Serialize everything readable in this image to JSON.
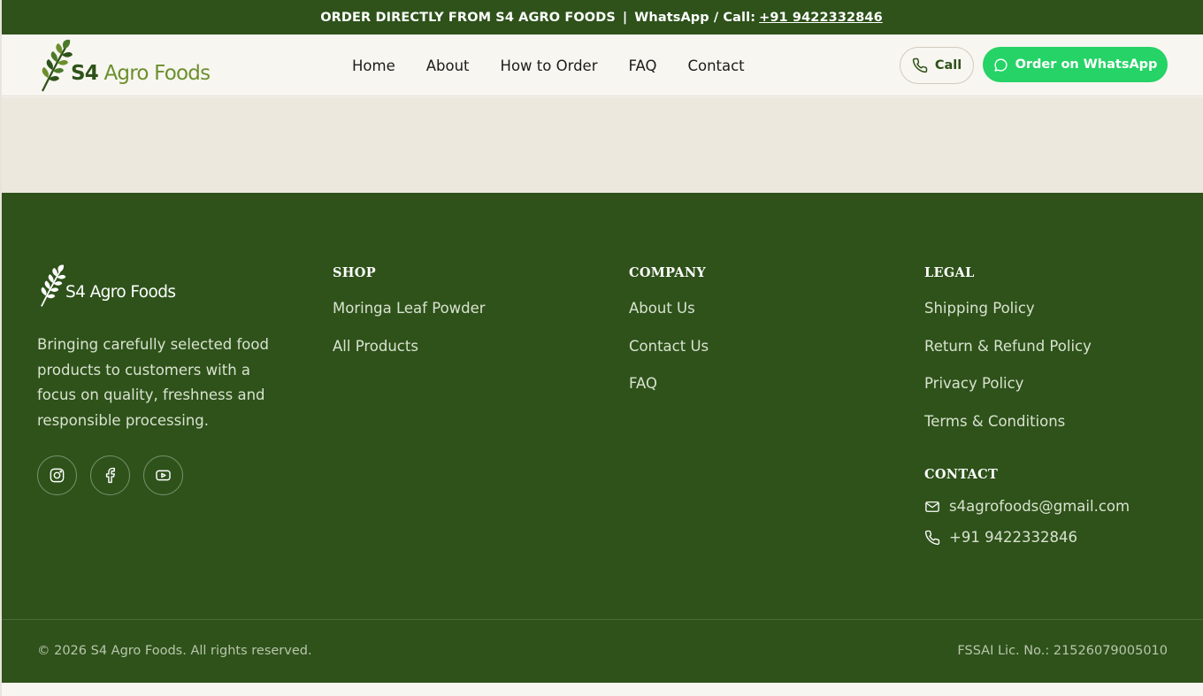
{
  "topbar": {
    "text": "ORDER DIRECTLY FROM S4 AGRO FOODS",
    "separator": "|",
    "contact_label": "WhatsApp / Call:",
    "phone": "+91 9422332846"
  },
  "brand": {
    "prefix": "S4",
    "name": "Agro Foods",
    "colors": {
      "primary": "#2e521a",
      "accent": "#6b8f2e",
      "whatsapp": "#25d366",
      "background": "#f8f6f0"
    }
  },
  "nav": {
    "items": [
      "Home",
      "About",
      "How to Order",
      "FAQ",
      "Contact"
    ]
  },
  "header_actions": {
    "call_label": "Call",
    "call_icon": "phone-icon",
    "whatsapp_label": "Order on WhatsApp",
    "whatsapp_icon": "whatsapp-icon"
  },
  "footer": {
    "brand_name": "S4 Agro Foods",
    "description": "Bringing carefully selected food products to customers with a focus on quality, freshness and responsible processing.",
    "socials": [
      "instagram-icon",
      "facebook-icon",
      "youtube-icon"
    ],
    "shop": {
      "heading": "SHOP",
      "links": [
        "Moringa Leaf Powder",
        "All Products"
      ]
    },
    "company": {
      "heading": "COMPANY",
      "links": [
        "About Us",
        "Contact Us",
        "FAQ"
      ]
    },
    "legal": {
      "heading": "LEGAL",
      "links": [
        "Shipping Policy",
        "Return & Refund Policy",
        "Privacy Policy",
        "Terms & Conditions"
      ]
    },
    "contact": {
      "heading": "CONTACT",
      "email": "s4agrofoods@gmail.com",
      "phone": "+91 9422332846"
    },
    "copyright": "© 2026 S4 Agro Foods. All rights reserved.",
    "fssai": "FSSAI Lic. No.: 21526079005010"
  }
}
